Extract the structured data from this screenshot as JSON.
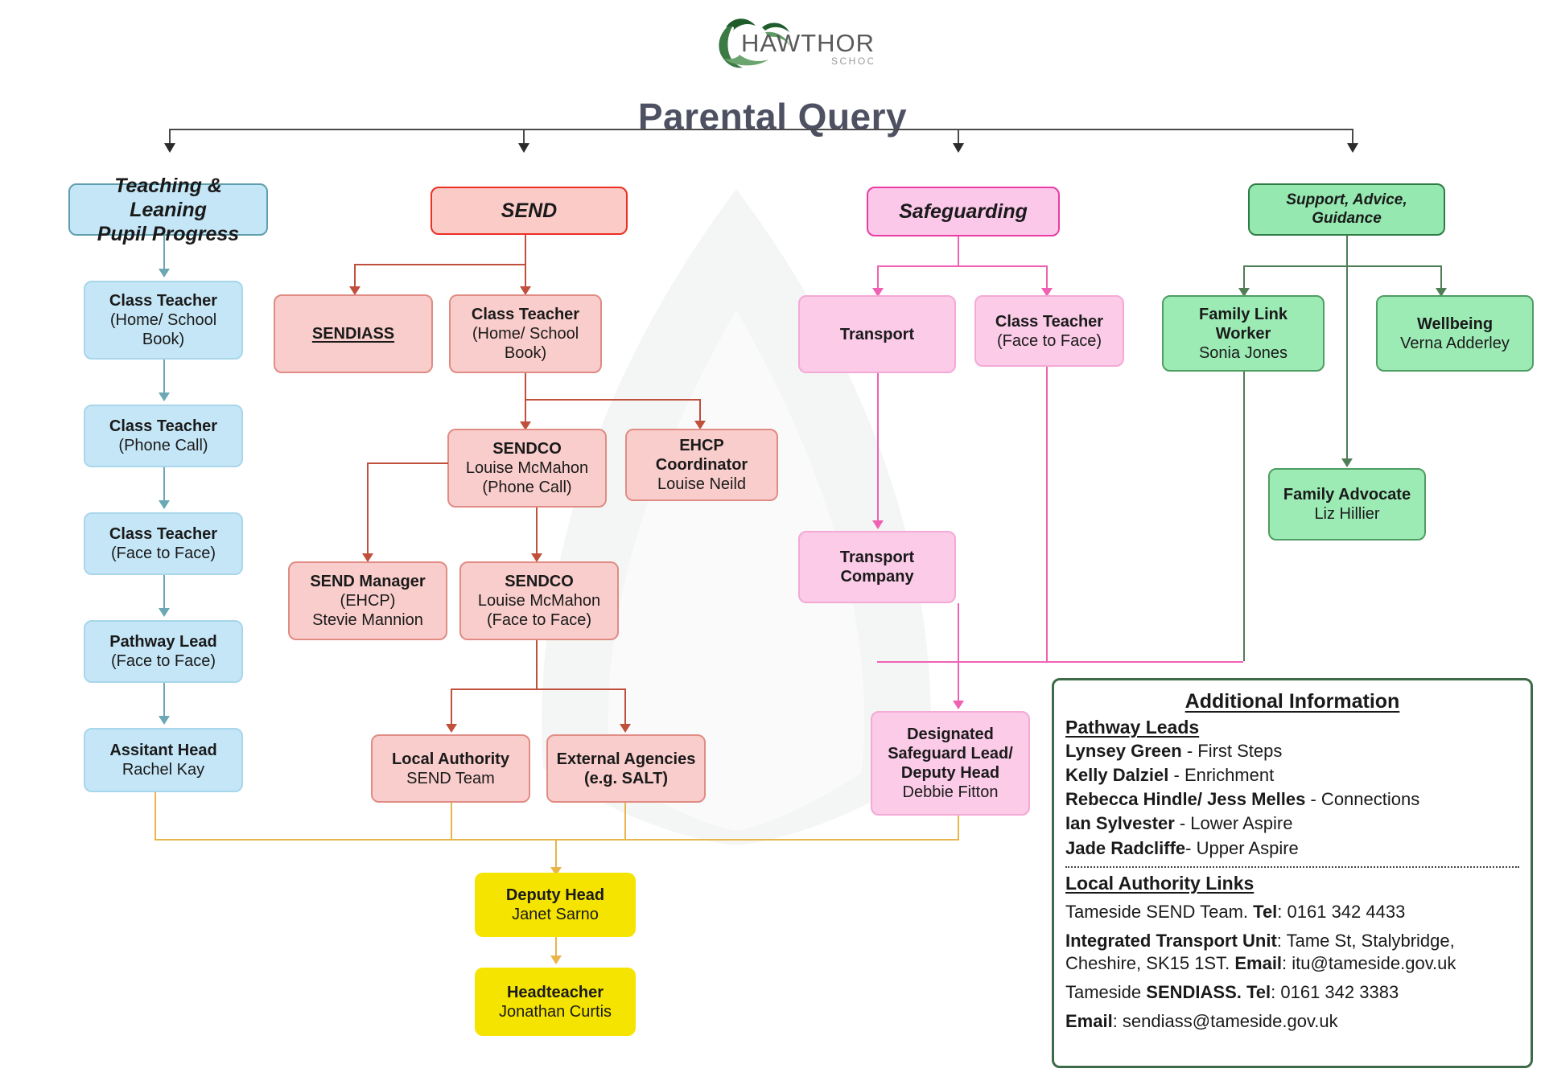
{
  "header": {
    "logo_name": "hawthorns-logo",
    "logo_word": "HAWTHORNS",
    "logo_sub": "SCHOOL",
    "title": "Parental Query"
  },
  "columns": {
    "teaching": {
      "header": {
        "line1": "Teaching & Leaning",
        "line2": "Pupil Progress"
      },
      "nodes": [
        {
          "l1": "Class Teacher",
          "l2": "(Home/ School",
          "l3": "Book)"
        },
        {
          "l1": "Class Teacher",
          "l2": "(Phone Call)"
        },
        {
          "l1": "Class Teacher",
          "l2": "(Face to Face)"
        },
        {
          "l1": "Pathway Lead",
          "l2": "(Face to Face)"
        },
        {
          "l1": "Assitant Head",
          "l2": "Rachel Kay"
        }
      ]
    },
    "send": {
      "header": {
        "line1": "SEND"
      },
      "sendiass": {
        "l1": "SENDIASS"
      },
      "class_teacher": {
        "l1": "Class Teacher",
        "l2": "(Home/ School",
        "l3": "Book)"
      },
      "sendco_phone": {
        "l1": "SENDCO",
        "l2": "Louise McMahon",
        "l3": "(Phone Call)"
      },
      "ehcp_coordinator": {
        "l1": "EHCP",
        "l1b": "Coordinator",
        "l2": "Louise Neild"
      },
      "send_manager": {
        "l1": "SEND Manager",
        "l2": "(EHCP)",
        "l3": "Stevie Mannion"
      },
      "sendco_face": {
        "l1": "SENDCO",
        "l2": "Louise McMahon",
        "l3": "(Face to Face)"
      },
      "local_authority": {
        "l1": "Local Authority",
        "l2": "SEND Team"
      },
      "external_agencies": {
        "l1": "External Agencies",
        "l2": "(e.g. SALT)"
      }
    },
    "safeguarding": {
      "header": {
        "line1": "Safeguarding"
      },
      "transport": {
        "l1": "Transport"
      },
      "class_teacher": {
        "l1": "Class Teacher",
        "l2": "(Face to Face)"
      },
      "transport_company": {
        "l1": "Transport",
        "l1b": "Company"
      },
      "dsl": {
        "l1": "Designated",
        "l1b": "Safeguard Lead/",
        "l1c": "Deputy Head",
        "l2": "Debbie Fitton"
      }
    },
    "support": {
      "header": {
        "line1": "Support, Advice,",
        "line2": "Guidance"
      },
      "family_link_worker": {
        "l1": "Family Link",
        "l1b": "Worker",
        "l2": "Sonia Jones"
      },
      "wellbeing": {
        "l1": "Wellbeing",
        "l2": "Verna Adderley"
      },
      "family_advocate": {
        "l1": "Family Advocate",
        "l2": "Liz Hillier"
      }
    },
    "leadership": {
      "deputy_head": {
        "l1": "Deputy Head",
        "l2": "Janet Sarno"
      },
      "headteacher": {
        "l1": "Headteacher",
        "l2": "Jonathan Curtis"
      }
    }
  },
  "info": {
    "title": "Additional Information",
    "pathway_leads_title": "Pathway Leads",
    "pathway_leads": [
      {
        "name": "Lynsey Green",
        "role": " - First Steps"
      },
      {
        "name": "Kelly Dalziel",
        "role": " - Enrichment"
      },
      {
        "name": "Rebecca Hindle/ Jess Melles",
        "role": " - Connections"
      },
      {
        "name": "Ian Sylvester",
        "role": " - Lower Aspire"
      },
      {
        "name": "Jade  Radcliffe",
        "role": "- Upper Aspire"
      }
    ],
    "la_links_title": "Local Authority Links",
    "la_links": [
      {
        "plain1": "Tameside SEND Team. ",
        "bold1": "Tel",
        "plain2": ": 0161 342 4433"
      },
      {
        "bold1": "Integrated Transport Unit",
        "plain2": ": Tame St, Stalybridge, Cheshire, SK15 1ST. ",
        "bold2": "Email",
        "plain3": ": itu@tameside.gov.uk"
      },
      {
        "plain1": "Tameside ",
        "bold1": "SENDIASS. Tel",
        "plain2": ": 0161 342 3383"
      },
      {
        "bold1": "Email",
        "plain2": ": sendiass@tameside.gov.uk"
      }
    ]
  },
  "colors": {
    "teaching": "#c5e6f7",
    "send": "#f9cdcb",
    "safeguarding": "#fbcbe8",
    "support": "#9cebb5",
    "leadership": "#f5e400",
    "title": "#4d5162"
  }
}
